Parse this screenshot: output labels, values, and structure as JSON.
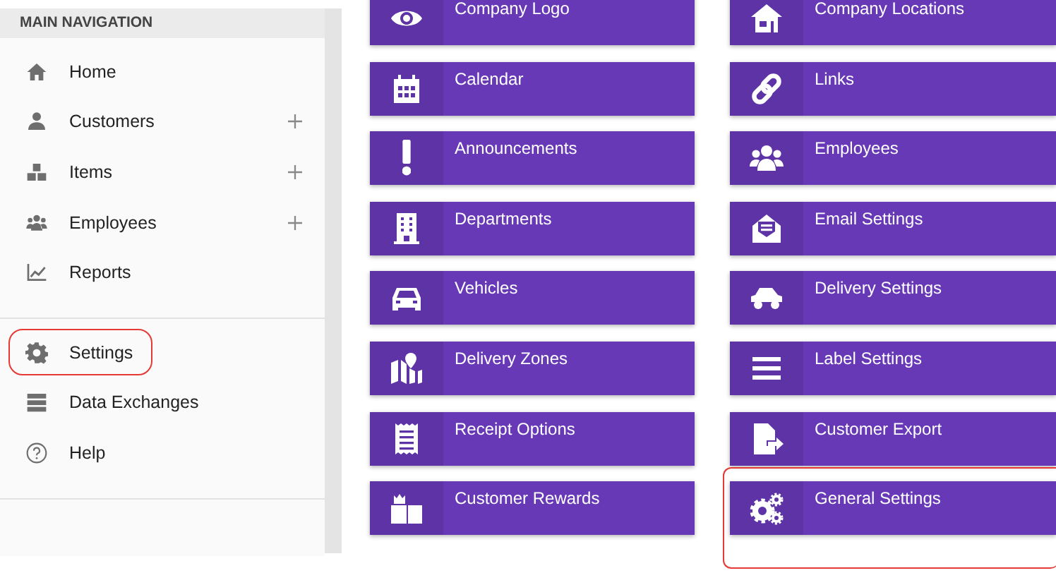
{
  "sidebar": {
    "header": "MAIN NAVIGATION",
    "groups": [
      [
        {
          "label": "Home",
          "expandable": false,
          "circled": false
        },
        {
          "label": "Customers",
          "expandable": true,
          "circled": false
        },
        {
          "label": "Items",
          "expandable": true,
          "circled": false
        },
        {
          "label": "Employees",
          "expandable": true,
          "circled": false
        },
        {
          "label": "Reports",
          "expandable": false,
          "circled": false
        }
      ],
      [
        {
          "label": "Settings",
          "expandable": false,
          "circled": true
        },
        {
          "label": "Data Exchanges",
          "expandable": false,
          "circled": false
        },
        {
          "label": "Help",
          "expandable": false,
          "circled": false
        }
      ]
    ]
  },
  "tiles": [
    {
      "label": "Company Logo",
      "circled": false
    },
    {
      "label": "Company Locations",
      "circled": false
    },
    {
      "label": "Calendar",
      "circled": false
    },
    {
      "label": "Links",
      "circled": false
    },
    {
      "label": "Announcements",
      "circled": false
    },
    {
      "label": "Employees",
      "circled": false
    },
    {
      "label": "Departments",
      "circled": false
    },
    {
      "label": "Email Settings",
      "circled": false
    },
    {
      "label": "Vehicles",
      "circled": false
    },
    {
      "label": "Delivery Settings",
      "circled": false
    },
    {
      "label": "Delivery Zones",
      "circled": false
    },
    {
      "label": "Label Settings",
      "circled": false
    },
    {
      "label": "Receipt Options",
      "circled": false
    },
    {
      "label": "Customer Export",
      "circled": false
    },
    {
      "label": "Customer Rewards",
      "circled": false
    },
    {
      "label": "General Settings",
      "circled": true
    }
  ]
}
